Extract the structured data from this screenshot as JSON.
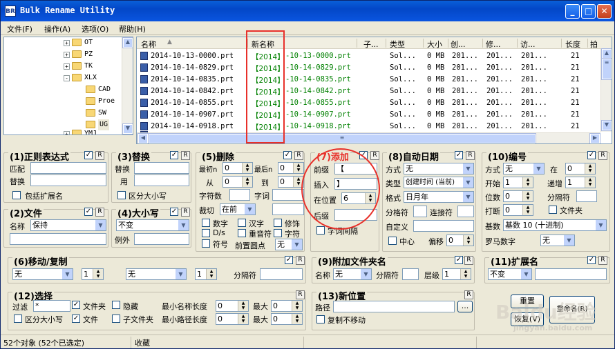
{
  "window": {
    "title": "Bulk Rename Utility",
    "app_icon": "BR"
  },
  "menu": [
    "文件(F)",
    "操作(A)",
    "选项(O)",
    "帮助(H)"
  ],
  "tree": [
    {
      "label": "OT",
      "expand": "+"
    },
    {
      "label": "PZ",
      "expand": "+"
    },
    {
      "label": "TK",
      "expand": "+"
    },
    {
      "label": "XLX",
      "expand": "-"
    },
    {
      "label": "CAD",
      "expand": ""
    },
    {
      "label": "Proe",
      "expand": ""
    },
    {
      "label": "SW",
      "expand": ""
    },
    {
      "label": "UG",
      "expand": ""
    },
    {
      "label": "YMJ",
      "expand": "+"
    }
  ],
  "list": {
    "columns": [
      "名称",
      "新名称",
      "子...",
      "类型",
      "大小",
      "创...",
      "修...",
      "访...",
      "长度",
      "拍"
    ],
    "rows": [
      {
        "name": "2014-10-13-0000.prt",
        "new_bracket": "【2014】",
        "new_rest": "-10-13-0000.prt",
        "sub": "",
        "type": "Sol...",
        "size": "0 MB",
        "created": "201...",
        "modified": "201...",
        "accessed": "201...",
        "length": "21"
      },
      {
        "name": "2014-10-14-0829.prt",
        "new_bracket": "【2014】",
        "new_rest": "-10-14-0829.prt",
        "sub": "",
        "type": "Sol...",
        "size": "0 MB",
        "created": "201...",
        "modified": "201...",
        "accessed": "201...",
        "length": "21"
      },
      {
        "name": "2014-10-14-0835.prt",
        "new_bracket": "【2014】",
        "new_rest": "-10-14-0835.prt",
        "sub": "",
        "type": "Sol...",
        "size": "0 MB",
        "created": "201...",
        "modified": "201...",
        "accessed": "201...",
        "length": "21"
      },
      {
        "name": "2014-10-14-0842.prt",
        "new_bracket": "【2014】",
        "new_rest": "-10-14-0842.prt",
        "sub": "",
        "type": "Sol...",
        "size": "0 MB",
        "created": "201...",
        "modified": "201...",
        "accessed": "201...",
        "length": "21"
      },
      {
        "name": "2014-10-14-0855.prt",
        "new_bracket": "【2014】",
        "new_rest": "-10-14-0855.prt",
        "sub": "",
        "type": "Sol...",
        "size": "0 MB",
        "created": "201...",
        "modified": "201...",
        "accessed": "201...",
        "length": "21"
      },
      {
        "name": "2014-10-14-0907.prt",
        "new_bracket": "【2014】",
        "new_rest": "-10-14-0907.prt",
        "sub": "",
        "type": "Sol...",
        "size": "0 MB",
        "created": "201...",
        "modified": "201...",
        "accessed": "201...",
        "length": "21"
      },
      {
        "name": "2014-10-14-0918.prt",
        "new_bracket": "【2014】",
        "new_rest": "-10-14-0918.prt",
        "sub": "",
        "type": "Sol...",
        "size": "0 MB",
        "created": "201...",
        "modified": "201...",
        "accessed": "201...",
        "length": "21"
      }
    ]
  },
  "p1": {
    "title": "(1)正则表达式",
    "match": "匹配",
    "replace": "替换",
    "ext": "包括扩展名"
  },
  "p2": {
    "title": "(2)文件",
    "name_label": "名称",
    "name_value": "保持"
  },
  "p3": {
    "title": "(3)替换",
    "replace": "替换",
    "with": "用",
    "case": "区分大小写"
  },
  "p4": {
    "title": "(4)大小写",
    "value": "不变",
    "except": "例外"
  },
  "p5": {
    "title": "(5)删除",
    "first_n": "最初n",
    "first_n_val": "0",
    "last_n": "最后n",
    "last_n_val": "0",
    "from": "从",
    "from_val": "0",
    "to": "到",
    "to_val": "0",
    "chars": "字符数",
    "words": "字词",
    "crop": "裁切",
    "crop_val": "在前",
    "digits": "数字",
    "chinese": "汉字",
    "trim": "修饰",
    "ds": "D/s",
    "accents": "重音符",
    "chars2": "字符",
    "symbols": "符号",
    "lead_dots": "前置圆点",
    "lead_val": "无"
  },
  "p7": {
    "title": "(7)添加",
    "prefix": "前缀",
    "prefix_val": "【",
    "insert": "插入",
    "insert_val": "】",
    "at_pos": "在位置",
    "at_pos_val": "6",
    "suffix": "后缀",
    "word_space": "字词间隔"
  },
  "p8": {
    "title": "(8)自动日期",
    "mode": "方式",
    "mode_val": "无",
    "type": "类型",
    "type_val": "创建时间 (当前)",
    "fmt": "格式",
    "fmt_val": "日月年",
    "sep": "分格符",
    "connect": "连接符",
    "custom": "自定义",
    "center": "中心",
    "offset": "偏移",
    "offset_val": "0"
  },
  "p10": {
    "title": "(10)编号",
    "mode": "方式",
    "mode_val": "无",
    "at": "在",
    "at_val": "0",
    "start": "开始",
    "start_val": "1",
    "incr": "递增",
    "incr_val": "1",
    "pad": "位数",
    "pad_val": "0",
    "sep": "分隔符",
    "break": "打断",
    "break_val": "0",
    "folder": "文件夹",
    "base": "基数",
    "base_val": "基数 10 (十进制)",
    "roman": "罗马数字",
    "roman_val": "无"
  },
  "p6": {
    "title": "(6)移动/复制",
    "v1": "无",
    "n1": "1",
    "v2": "无",
    "n2": "1",
    "sep": "分隔符"
  },
  "p9": {
    "title": "(9)附加文件夹名",
    "name": "名称",
    "name_val": "无",
    "sep": "分隔符",
    "levels": "层级",
    "levels_val": "1"
  },
  "p11": {
    "title": "(11)扩展名",
    "value": "不变"
  },
  "p12": {
    "title": "(12)选择",
    "filter": "过滤",
    "filter_val": "*",
    "folders": "文件夹",
    "hidden": "隐藏",
    "min_name": "最小名称长度",
    "min_name_val": "0",
    "max": "最大",
    "max_val": "0",
    "case": "区分大小写",
    "files": "文件",
    "subfolders": "子文件夹",
    "min_path": "最小路径长度",
    "min_path_val": "0",
    "max2": "最大",
    "max2_val": "0"
  },
  "p13": {
    "title": "(13)新位置",
    "path": "路径",
    "browse": "...",
    "copy": "复制不移动"
  },
  "buttons": {
    "reset": "重置",
    "restore": "恢复(V)",
    "rename": "重命名(R)",
    "r": "R"
  },
  "status": {
    "count": "52个对象 (52个已选定)",
    "fav": "收藏"
  },
  "watermark": {
    "brand": "Baidu经验",
    "url": "jingyan.baidu.com"
  },
  "colors": {
    "title_bar": "#0a55e0",
    "highlight": "#e8302a",
    "new_name": "#008000",
    "panel_title_7": "#e8302a"
  }
}
